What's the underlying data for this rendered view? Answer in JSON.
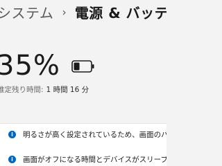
{
  "breadcrumb": {
    "parent": "システム",
    "separator": "›",
    "current": "電源 & バッテリー"
  },
  "battery": {
    "percent_text": "35%",
    "level": 0.35,
    "icon": "battery-icon",
    "estimate_label": "推定残り時間:",
    "estimate_value": "1 時間 16 分"
  },
  "notices": [
    {
      "icon": "info-icon",
      "glyph": "i",
      "text": "明るさが高く設定されているため、画面のバッテリー消"
    },
    {
      "icon": "info-icon",
      "glyph": "i",
      "text": "画面がオフになる時間とデバイスがスリープ状態になる"
    }
  ],
  "colors": {
    "background": "#f3f3f3",
    "card": "#ffffff",
    "accent": "#0067c0",
    "battery_fill": "#1a1a1a"
  }
}
